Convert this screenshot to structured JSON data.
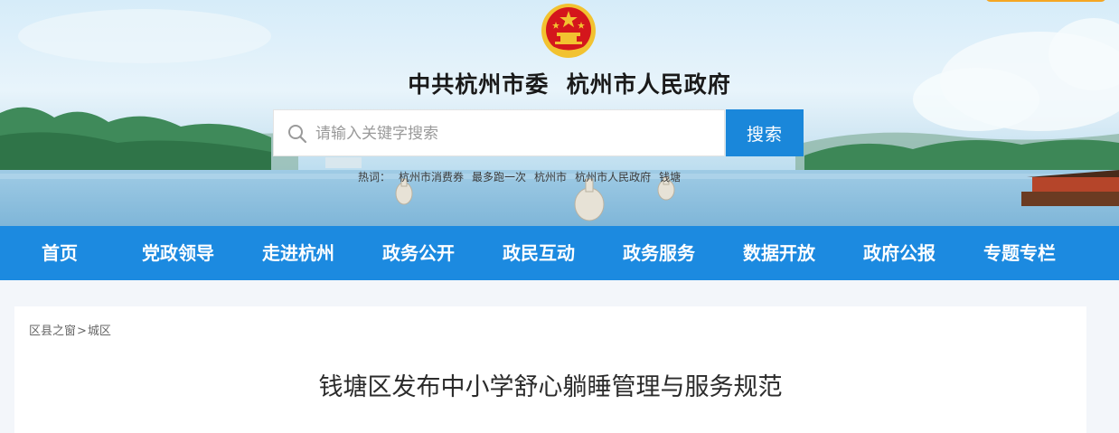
{
  "header": {
    "title_left": "中共杭州市委",
    "title_right": "杭州市人民政府"
  },
  "search": {
    "placeholder": "请输入关键字搜索",
    "button_label": "搜索"
  },
  "hot_words": [
    "热词：",
    "杭州市消费券",
    "最多跑一次",
    "杭州市",
    "杭州市人民政府",
    "钱塘"
  ],
  "nav": {
    "items": [
      {
        "label": "首页"
      },
      {
        "label": "党政领导"
      },
      {
        "label": "走进杭州"
      },
      {
        "label": "政务公开"
      },
      {
        "label": "政民互动"
      },
      {
        "label": "政务服务"
      },
      {
        "label": "数据开放"
      },
      {
        "label": "政府公报"
      },
      {
        "label": "专题专栏"
      }
    ]
  },
  "breadcrumb": {
    "items": [
      "区县之窗",
      "城区"
    ],
    "separator": ">"
  },
  "article": {
    "title": "钱塘区发布中小学舒心躺睡管理与服务规范"
  },
  "colors": {
    "nav_bg": "#1c8ae0",
    "search_button": "#1a87da",
    "accent_tab": "#f5a623",
    "emblem_red": "#d4161c",
    "emblem_gold": "#f2c230"
  },
  "icons": {
    "emblem": "national-emblem-icon",
    "search": "search-icon"
  }
}
